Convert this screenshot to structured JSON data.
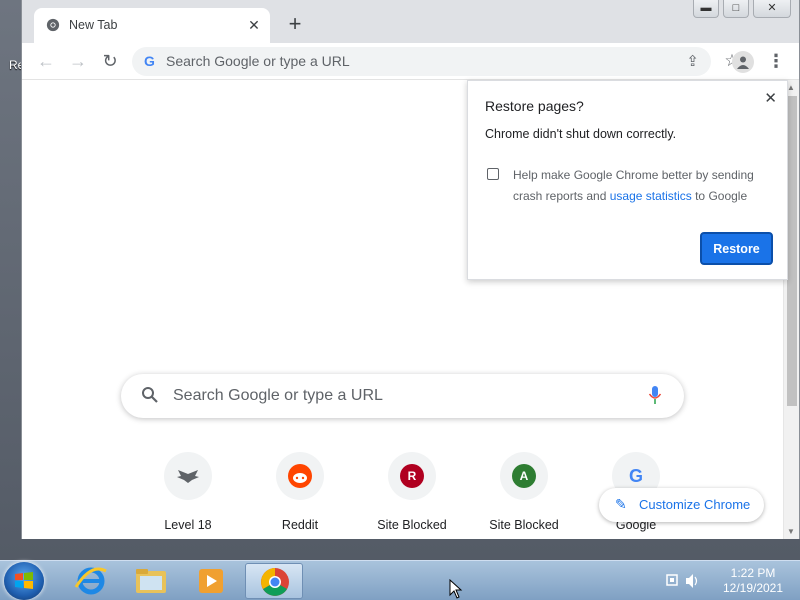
{
  "desktop": {
    "label": "Re"
  },
  "window": {
    "tab": {
      "title": "New Tab"
    },
    "controls": {
      "minimize": "▬",
      "maximize": "□",
      "close": "✕"
    }
  },
  "toolbar": {
    "omnibox_placeholder": "Search Google or type a URL"
  },
  "ntp": {
    "search_placeholder": "Search Google or type a URL",
    "shortcuts": [
      {
        "label": "Level 18",
        "color": "#5f6368",
        "letter": ""
      },
      {
        "label": "Reddit",
        "color": "#ff4500",
        "letter": ""
      },
      {
        "label": "Site Blocked",
        "color": "#b00020",
        "letter": "R"
      },
      {
        "label": "Site Blocked",
        "color": "#2e7d32",
        "letter": "A"
      },
      {
        "label": "Google",
        "color": "#ffffff",
        "letter": "G"
      }
    ],
    "customize_label": "Customize Chrome"
  },
  "restore_popup": {
    "title": "Restore pages?",
    "message": "Chrome didn't shut down correctly.",
    "checkbox_text_before": "Help make Google Chrome better by sending crash reports and ",
    "checkbox_link": "usage statistics",
    "checkbox_text_after": " to Google",
    "button": "Restore"
  },
  "taskbar": {
    "time": "1:22 PM",
    "date": "12/19/2021"
  },
  "colors": {
    "accent": "#1a73e8"
  }
}
